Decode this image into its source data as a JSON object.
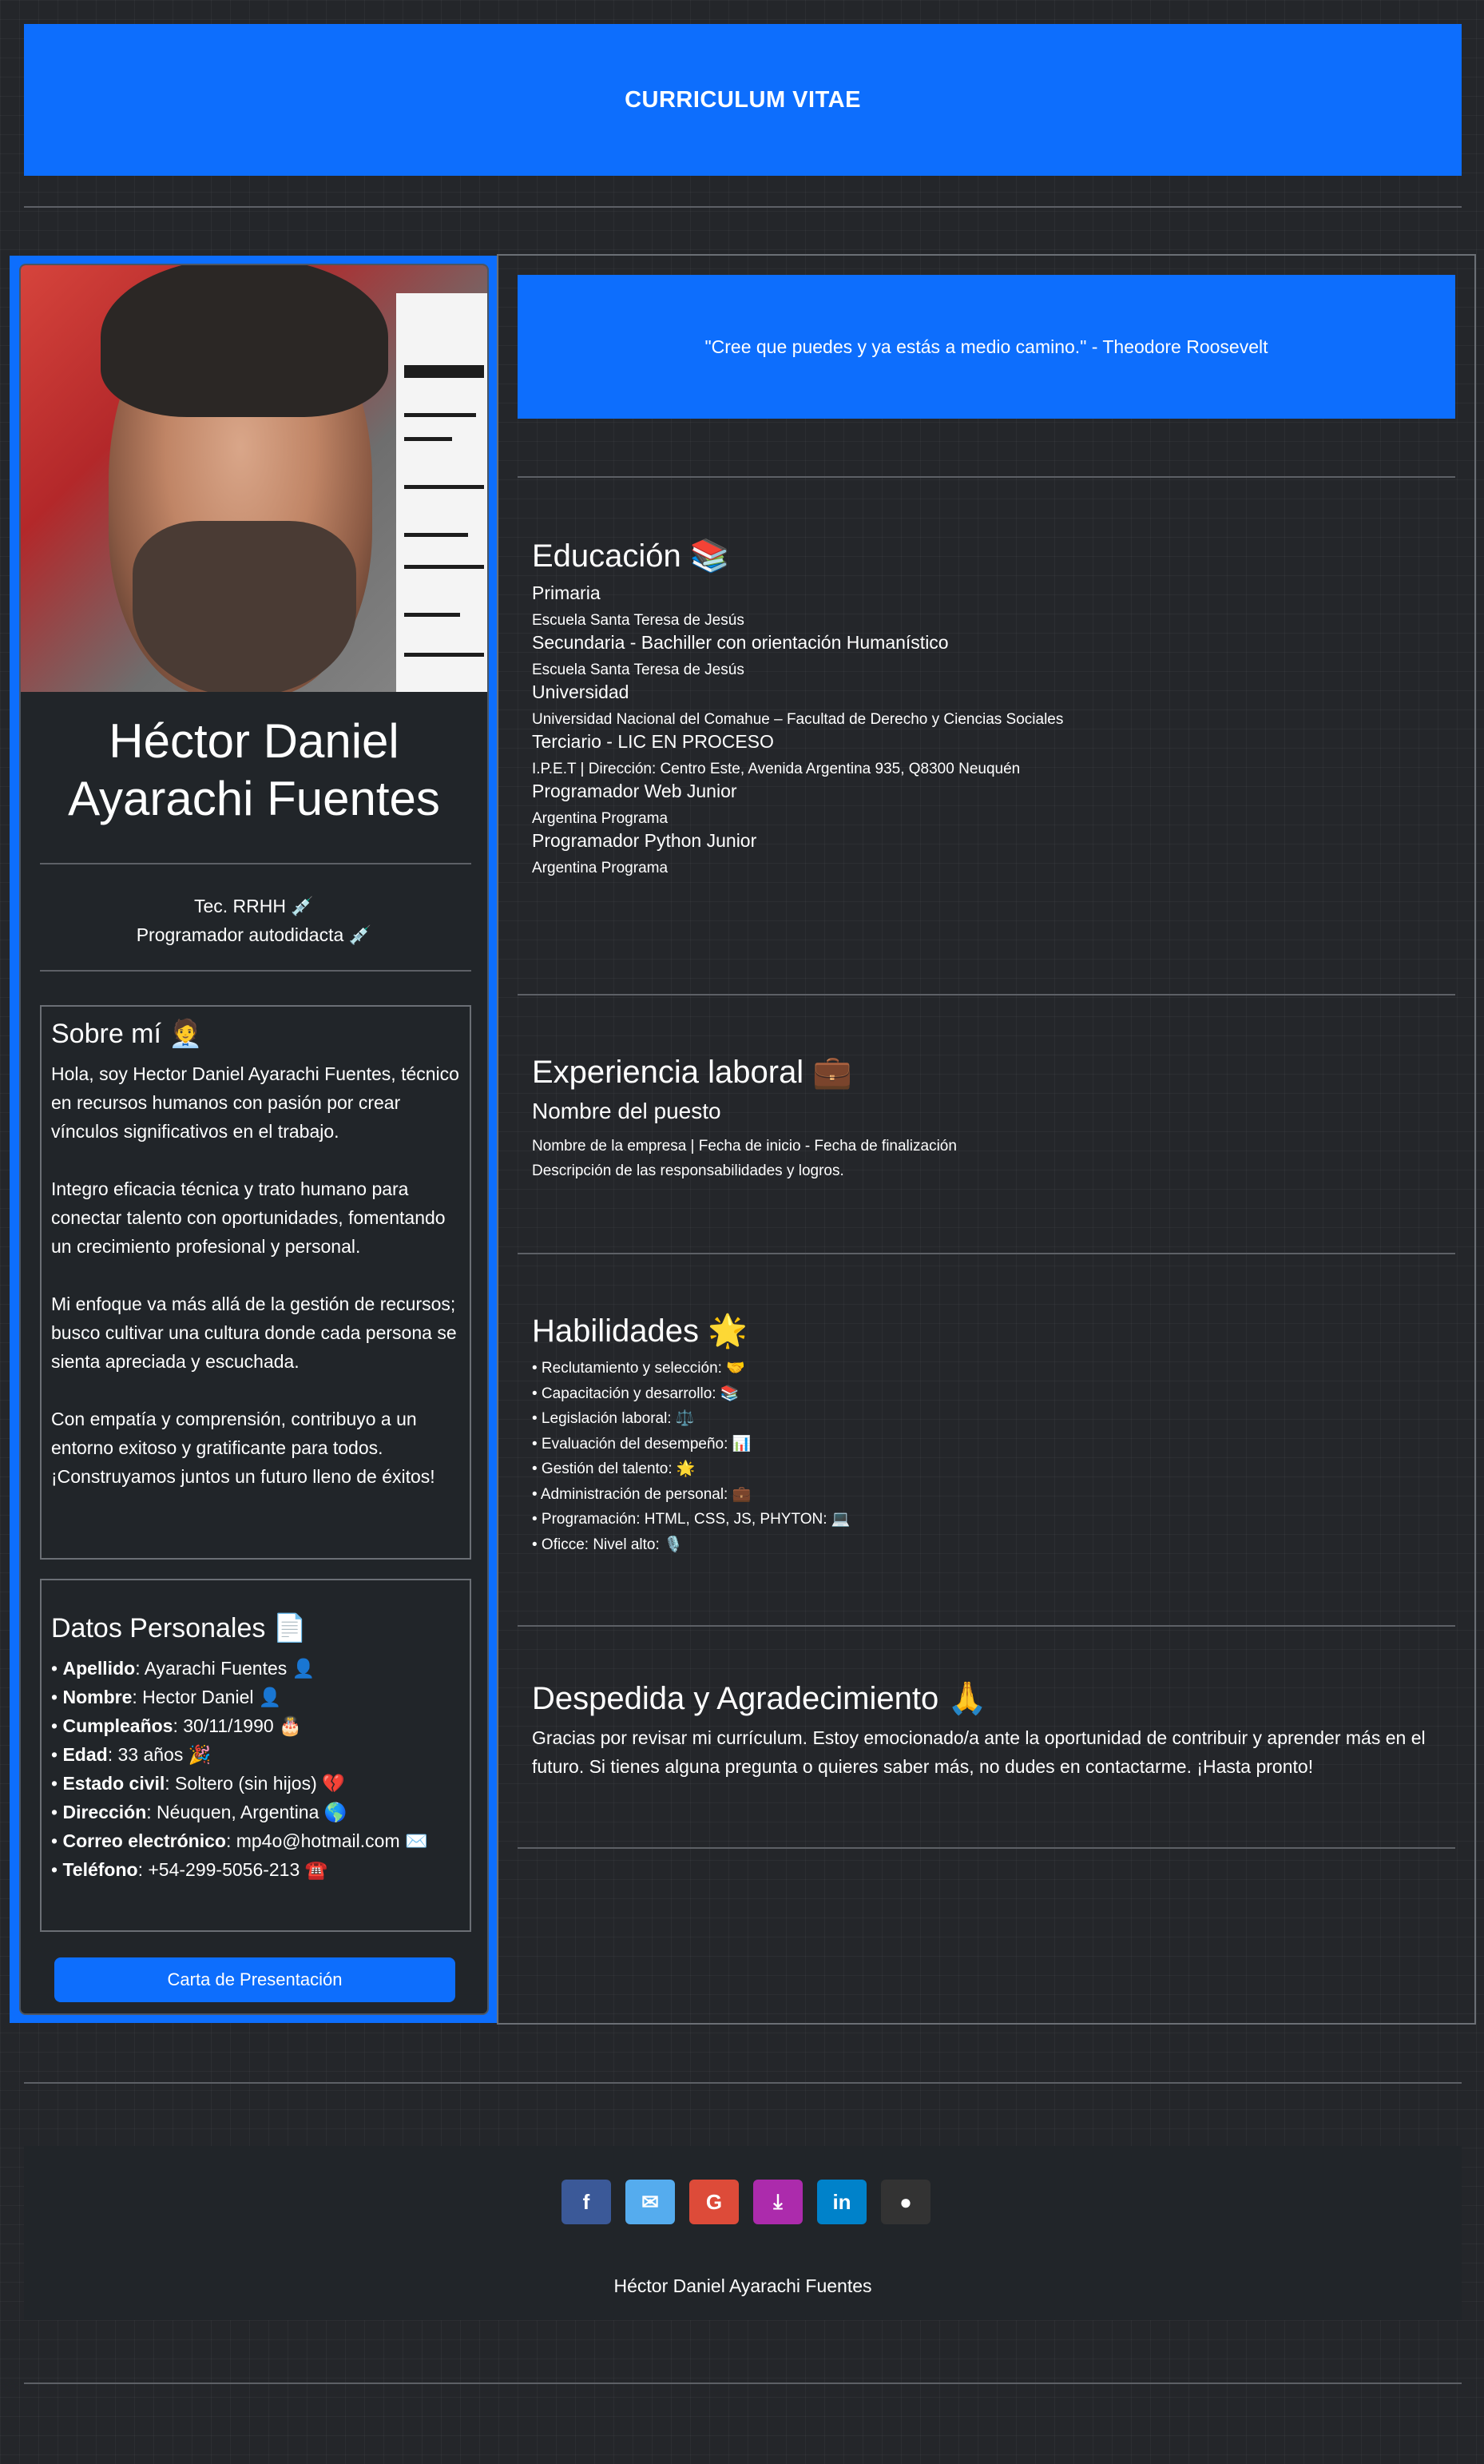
{
  "header": {
    "title": "CURRICULUM VITAE"
  },
  "profile": {
    "name": "Héctor Daniel Ayarachi Fuentes",
    "title_1": "Tec. RRHH 💉",
    "title_2": "Programador autodidacta 💉"
  },
  "about": {
    "heading": "Sobre mí 🧑‍💼",
    "paragraphs": [
      "Hola, soy Hector Daniel Ayarachi Fuentes, técnico en recursos humanos con pasión por crear vínculos significativos en el trabajo.",
      "Integro eficacia técnica y trato humano para conectar talento con oportunidades, fomentando un crecimiento profesional y personal.",
      "Mi enfoque va más allá de la gestión de recursos; busco cultivar una cultura donde cada persona se sienta apreciada y escuchada.",
      "Con empatía y comprensión, contribuyo a un entorno exitoso y gratificante para todos. ¡Construyamos juntos un futuro lleno de éxitos!"
    ]
  },
  "personal": {
    "heading": "Datos Personales 📄",
    "items": [
      {
        "label": "Apellido",
        "value": ": Ayarachi Fuentes 👤"
      },
      {
        "label": "Nombre",
        "value": ": Hector Daniel 👤"
      },
      {
        "label": "Cumpleaños",
        "value": ": 30/11/1990 🎂"
      },
      {
        "label": "Edad",
        "value": ": 33 años 🎉"
      },
      {
        "label": "Estado civil",
        "value": ": Soltero (sin hijos) 💔"
      },
      {
        "label": "Dirección",
        "value": ": Néuquen, Argentina 🌎"
      },
      {
        "label": "Correo electrónico",
        "value": ": mp4o@hotmail.com ✉️"
      },
      {
        "label": "Teléfono",
        "value": ": +54-299-5056-213 ☎️"
      }
    ]
  },
  "cover_letter_button": "Carta de Presentación",
  "quote": "\"Cree que puedes y ya estás a medio camino.\" - Theodore Roosevelt",
  "education": {
    "heading": "Educación 📚",
    "items": [
      {
        "title": "Primaria",
        "sub": "Escuela Santa Teresa de Jesús"
      },
      {
        "title": "Secundaria - Bachiller con orientación Humanístico",
        "sub": "Escuela Santa Teresa de Jesús"
      },
      {
        "title": "Universidad",
        "sub": "Universidad Nacional del Comahue – Facultad de Derecho y Ciencias Sociales"
      },
      {
        "title": "Terciario - LIC EN PROCESO",
        "sub": "I.P.E.T | Dirección: Centro Este, Avenida Argentina 935, Q8300 Neuquén"
      },
      {
        "title": "Programador Web Junior",
        "sub": "Argentina Programa"
      },
      {
        "title": "Programador Python Junior",
        "sub": "Argentina Programa"
      }
    ]
  },
  "experience": {
    "heading": "Experiencia laboral 💼",
    "job_title": "Nombre del puesto",
    "company_line": "Nombre de la empresa | Fecha de inicio - Fecha de finalización",
    "description": "Descripción de las responsabilidades y logros."
  },
  "skills": {
    "heading": "Habilidades 🌟",
    "items": [
      "• Reclutamiento y selección: 🤝",
      "• Capacitación y desarrollo: 📚",
      "• Legislación laboral: ⚖️",
      "• Evaluación del desempeño: 📊",
      "• Gestión del talento: 🌟",
      "• Administración de personal: 💼",
      "• Programación: HTML, CSS, JS, PHYTON: 💻",
      "• Oficce: Nivel alto: 🎙️"
    ]
  },
  "farewell": {
    "heading": "Despedida y Agradecimiento 🙏",
    "text": "Gracias por revisar mi currículum. Estoy emocionado/a ante la oportunidad de contribuir y aprender más en el futuro. Si tienes alguna pregunta o quieres saber más, no dudes en contactarme. ¡Hasta pronto!"
  },
  "footer": {
    "name": "Héctor Daniel Ayarachi Fuentes",
    "social": [
      {
        "icon": "facebook-icon",
        "glyph": "f",
        "color": "#3b5998"
      },
      {
        "icon": "mail-icon",
        "glyph": "✉",
        "color": "#55acee"
      },
      {
        "icon": "google-icon",
        "glyph": "G",
        "color": "#dd4b39"
      },
      {
        "icon": "download-icon",
        "glyph": "⤓",
        "color": "#ac2bac"
      },
      {
        "icon": "linkedin-icon",
        "glyph": "in",
        "color": "#0082ca"
      },
      {
        "icon": "github-icon",
        "glyph": "●",
        "color": "#333333"
      }
    ]
  }
}
